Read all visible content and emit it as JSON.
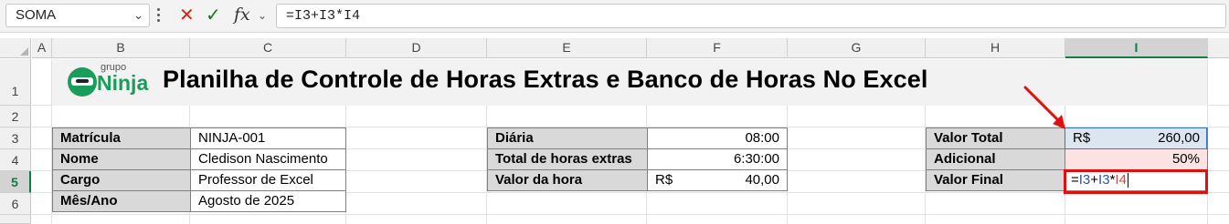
{
  "formula_bar": {
    "name_box": "SOMA",
    "cancel_icon": "close-icon",
    "enter_icon": "check-icon",
    "fx_label": "fx",
    "formula": "=I3+I3*I4"
  },
  "columns": [
    "A",
    "B",
    "C",
    "D",
    "E",
    "F",
    "G",
    "H",
    "I"
  ],
  "rows": [
    "1",
    "2",
    "3",
    "4",
    "5",
    "6"
  ],
  "active_column": "I",
  "active_row": "5",
  "title": "Planilha de Controle de Horas Extras e Banco de Horas No Excel",
  "logo": {
    "small": "grupo",
    "big": "Ninja"
  },
  "employee_table": [
    {
      "label": "Matrícula",
      "value": "NINJA-001"
    },
    {
      "label": "Nome",
      "value": "Cledison Nascimento"
    },
    {
      "label": "Cargo",
      "value": "Professor de Excel"
    },
    {
      "label": "Mês/Ano",
      "value": "Agosto de 2025"
    }
  ],
  "hours_table": [
    {
      "label": "Diária",
      "currency": "",
      "value": "08:00"
    },
    {
      "label": "Total de horas extras",
      "currency": "",
      "value": "6:30:00"
    },
    {
      "label": "Valor da hora",
      "currency": "R$",
      "value": "40,00"
    }
  ],
  "value_table": [
    {
      "label": "Valor Total",
      "currency": "R$",
      "value": "260,00"
    },
    {
      "label": "Adicional",
      "currency": "",
      "value": "50%"
    },
    {
      "label": "Valor Final",
      "currency": "",
      "value": ""
    }
  ],
  "editing_formula": {
    "eq": "=",
    "ref1": "I3",
    "plus": "+",
    "ref2": "I3",
    "mul": "*",
    "ref3": "I4"
  },
  "colors": {
    "ref_blue": "#2f5597",
    "ref_red": "#c0504d",
    "highlight_red": "#e01010",
    "excel_green": "#107c41"
  }
}
